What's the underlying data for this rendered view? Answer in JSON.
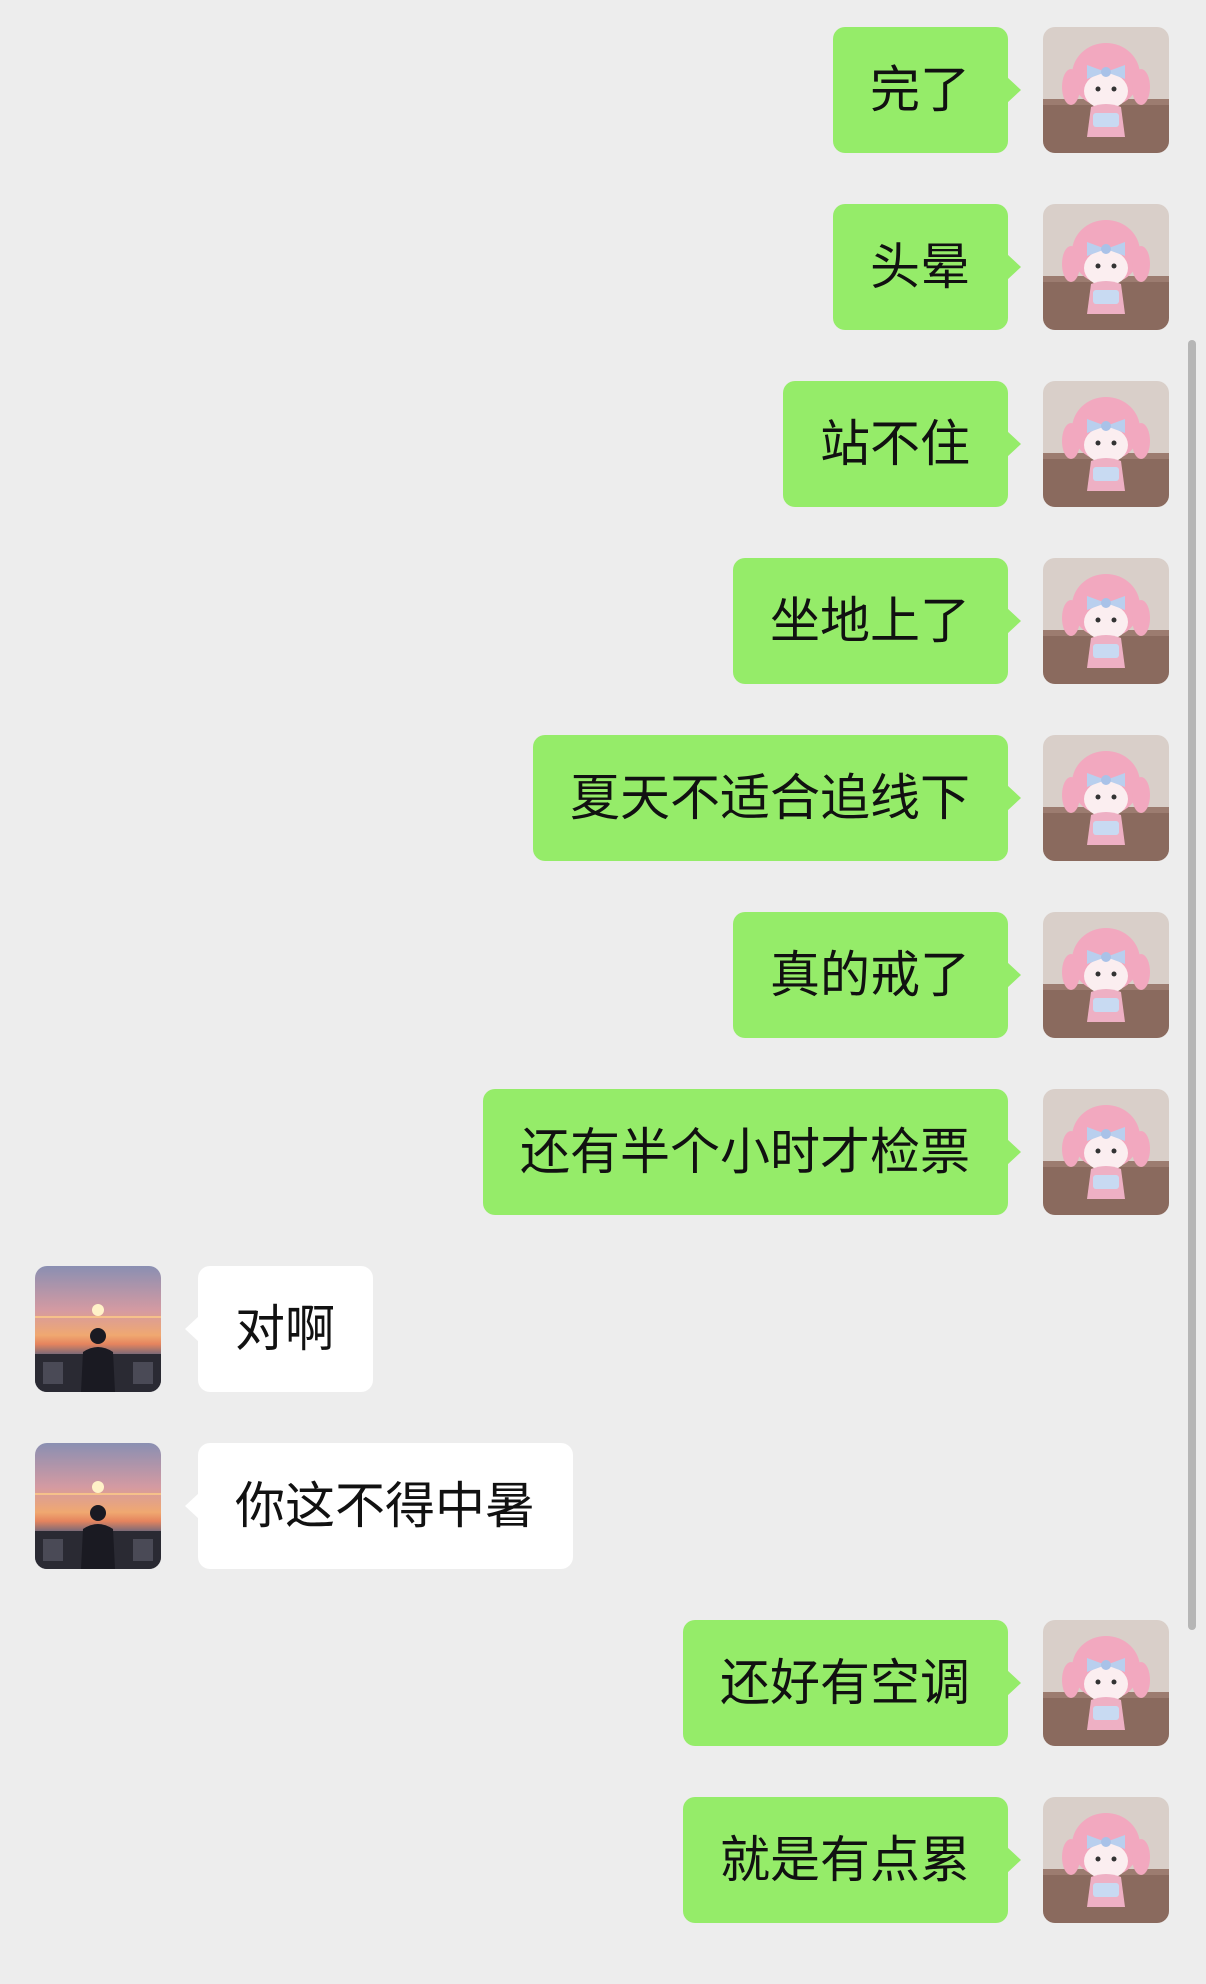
{
  "colors": {
    "background": "#ededed",
    "sent_bubble": "#95ec69",
    "received_bubble": "#ffffff",
    "text": "#111111",
    "scrollbar": "#b6b6b6"
  },
  "avatars": {
    "self": "pink-plush-doll-avatar",
    "contact": "sunset-silhouette-avatar"
  },
  "messages": [
    {
      "side": "right",
      "text": "完了"
    },
    {
      "side": "right",
      "text": "头晕"
    },
    {
      "side": "right",
      "text": "站不住"
    },
    {
      "side": "right",
      "text": "坐地上了"
    },
    {
      "side": "right",
      "text": "夏天不适合追线下"
    },
    {
      "side": "right",
      "text": "真的戒了"
    },
    {
      "side": "right",
      "text": "还有半个小时才检票"
    },
    {
      "side": "left",
      "text": "对啊"
    },
    {
      "side": "left",
      "text": "你这不得中暑"
    },
    {
      "side": "right",
      "text": "还好有空调"
    },
    {
      "side": "right",
      "text": "就是有点累"
    }
  ]
}
